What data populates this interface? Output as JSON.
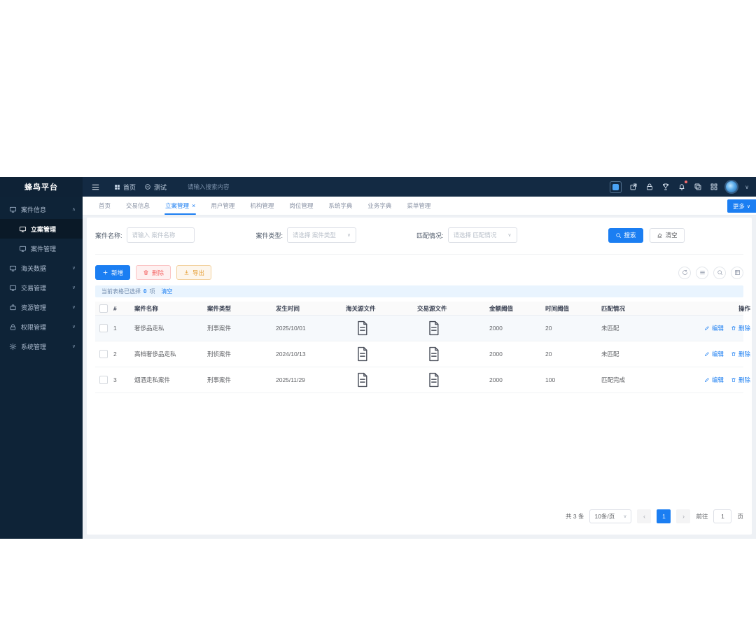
{
  "brand": "蜂鸟平台",
  "topbar": {
    "home_label": "首页",
    "test_label": "测试",
    "search_placeholder": "请输入搜索内容"
  },
  "icons": {
    "chevron_up": "∧",
    "chevron_down": "∨",
    "close": "×",
    "prev": "‹",
    "next": "›"
  },
  "sidebar": {
    "items": [
      {
        "label": "案件信息"
      },
      {
        "label": "立案管理"
      },
      {
        "label": "案件管理"
      },
      {
        "label": "海关数据"
      },
      {
        "label": "交易管理"
      },
      {
        "label": "资源管理"
      },
      {
        "label": "权限管理"
      },
      {
        "label": "系统管理"
      }
    ]
  },
  "tabs": {
    "items": [
      {
        "label": "首页"
      },
      {
        "label": "交易信息"
      },
      {
        "label": "立案管理",
        "active": true,
        "closable": true
      },
      {
        "label": "用户管理"
      },
      {
        "label": "机构管理"
      },
      {
        "label": "岗位管理"
      },
      {
        "label": "系统字典"
      },
      {
        "label": "业务字典"
      },
      {
        "label": "菜单管理"
      }
    ],
    "more_label": "更多"
  },
  "filters": {
    "name_label": "案件名称:",
    "name_placeholder": "请输入 案件名称",
    "type_label": "案件类型:",
    "type_placeholder": "请选择 案件类型",
    "match_label": "匹配情况:",
    "match_placeholder": "请选择 匹配情况",
    "search_button": "搜索",
    "clear_button": "清空"
  },
  "toolbar": {
    "add_button": "新增",
    "delete_button": "删除",
    "export_button": "导出"
  },
  "selection_bar": {
    "prefix": "当前表格已选择",
    "count": "0",
    "suffix": "项",
    "clear_link": "清空"
  },
  "table": {
    "headers": [
      "#",
      "案件名称",
      "案件类型",
      "发生时间",
      "海关源文件",
      "交易源文件",
      "金额阈值",
      "时间阈值",
      "匹配情况",
      "操作"
    ],
    "rows": [
      {
        "index": "1",
        "name": "奢侈品走私",
        "type": "刑事案件",
        "date": "2025/10/01",
        "amount": "2000",
        "time": "20",
        "match": "未匹配"
      },
      {
        "index": "2",
        "name": "高档奢侈品走私",
        "type": "刑侦案件",
        "date": "2024/10/13",
        "amount": "2000",
        "time": "20",
        "match": "未匹配"
      },
      {
        "index": "3",
        "name": "烟酒走私案件",
        "type": "刑事案件",
        "date": "2025/11/29",
        "amount": "2000",
        "time": "100",
        "match": "匹配完成"
      }
    ],
    "edit_label": "编辑",
    "delete_label": "删除"
  },
  "pagination": {
    "total": "共 3 条",
    "page_size": "10条/页",
    "current_page": "1",
    "goto_label": "前往",
    "goto_value": "1",
    "page_unit": "页"
  },
  "colors": {
    "accent": "#1b7ef2",
    "danger": "#f56c6c",
    "warning": "#e6a23c",
    "sidebar": "#0e2337",
    "topbar": "#132a43"
  }
}
